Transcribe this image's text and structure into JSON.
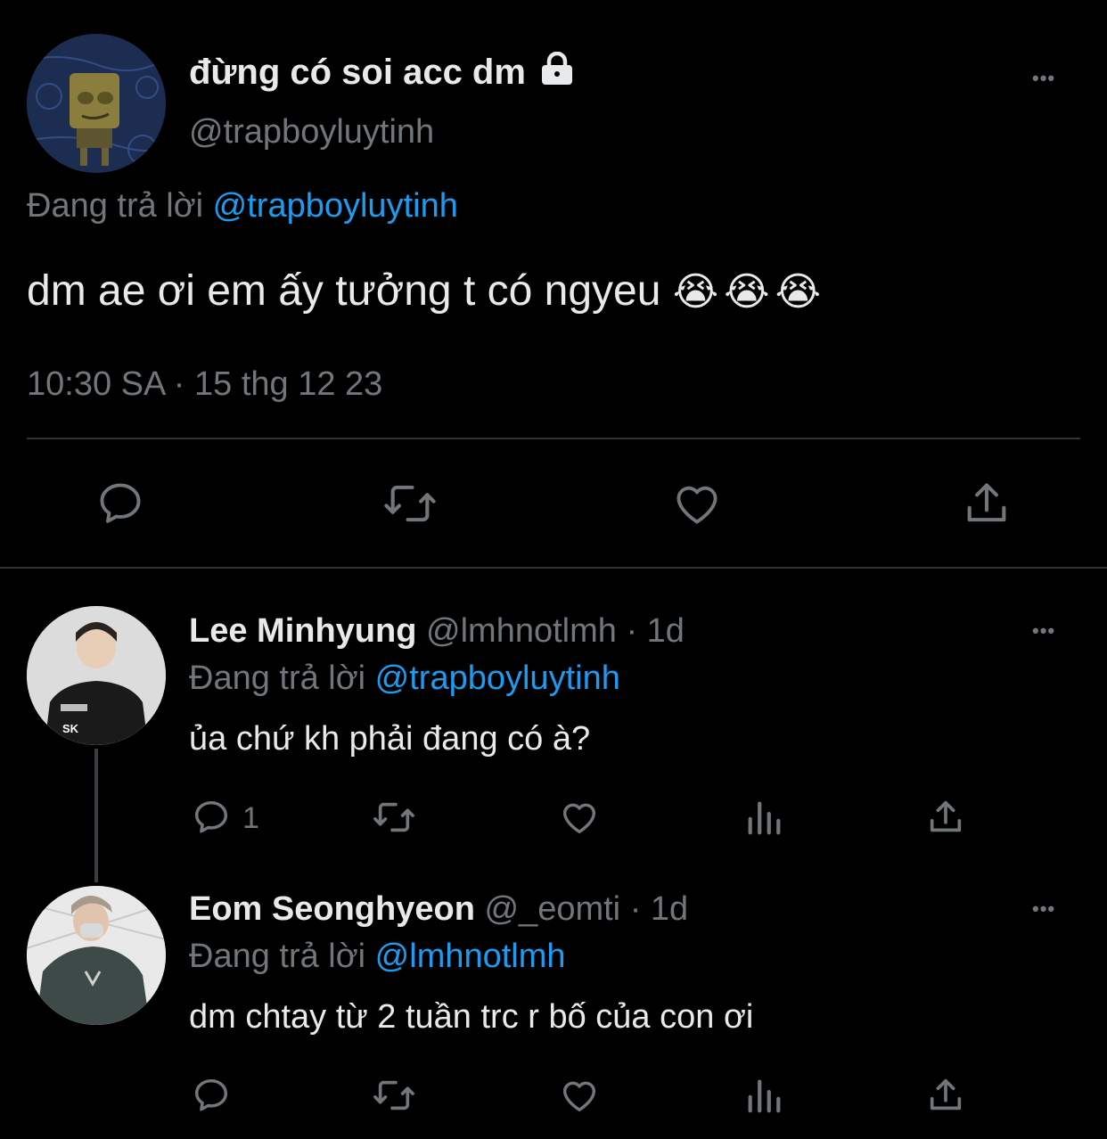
{
  "main_tweet": {
    "display_name": "đừng có soi acc dm",
    "handle": "@trapboyluytinh",
    "replying_label": "Đang trả lời",
    "replying_to": "@trapboyluytinh",
    "text": "dm ae ơi em ấy tưởng t có ngyeu",
    "emojis": "😭😭😭",
    "timestamp": "10:30 SA · 15 thg 12 23",
    "icons": [
      "reply-icon",
      "retweet-icon",
      "like-icon",
      "share-icon"
    ]
  },
  "replies": [
    {
      "display_name": "Lee Minhyung",
      "handle": "@lmhnotlmh",
      "time": "· 1d",
      "replying_label": "Đang trả lời",
      "replying_to": "@trapboyluytinh",
      "text": "ủa chứ kh phải đang có à?",
      "reply_count": "1"
    },
    {
      "display_name": "Eom Seonghyeon",
      "handle": "@_eomti",
      "time": "· 1d",
      "replying_label": "Đang trả lời",
      "replying_to": "@lmhnotlmh",
      "text": "dm chtay từ 2 tuần trc r bố của con ơi",
      "reply_count": ""
    }
  ],
  "more_glyph": "•••",
  "colors": {
    "background": "#000000",
    "text": "#e7e9ea",
    "secondary": "#71767b",
    "link": "#1d9bf0",
    "divider": "#2f3336"
  }
}
